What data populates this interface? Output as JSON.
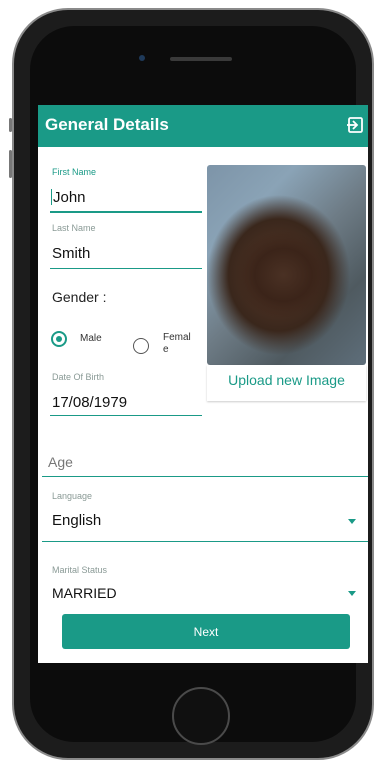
{
  "app": {
    "title": "General Details",
    "accent_color": "#1a9a87"
  },
  "icons": {
    "exit": "exit-to-app-icon"
  },
  "form": {
    "first_name": {
      "label": "First Name",
      "value": "John"
    },
    "last_name": {
      "label": "Last Name",
      "value": "Smith"
    },
    "gender": {
      "label": "Gender :",
      "options": [
        {
          "label": "Male",
          "selected": true
        },
        {
          "label": "Femal\ne",
          "selected": false
        }
      ]
    },
    "dob": {
      "label": "Date Of Birth",
      "value": "17/08/1979"
    },
    "age": {
      "placeholder": "Age"
    },
    "language": {
      "label": "Language",
      "value": "English"
    },
    "marital_status": {
      "label": "Marital Status",
      "value": "MARRIED"
    }
  },
  "photo": {
    "upload_label": "Upload new Image"
  },
  "actions": {
    "next_label": "Next"
  }
}
